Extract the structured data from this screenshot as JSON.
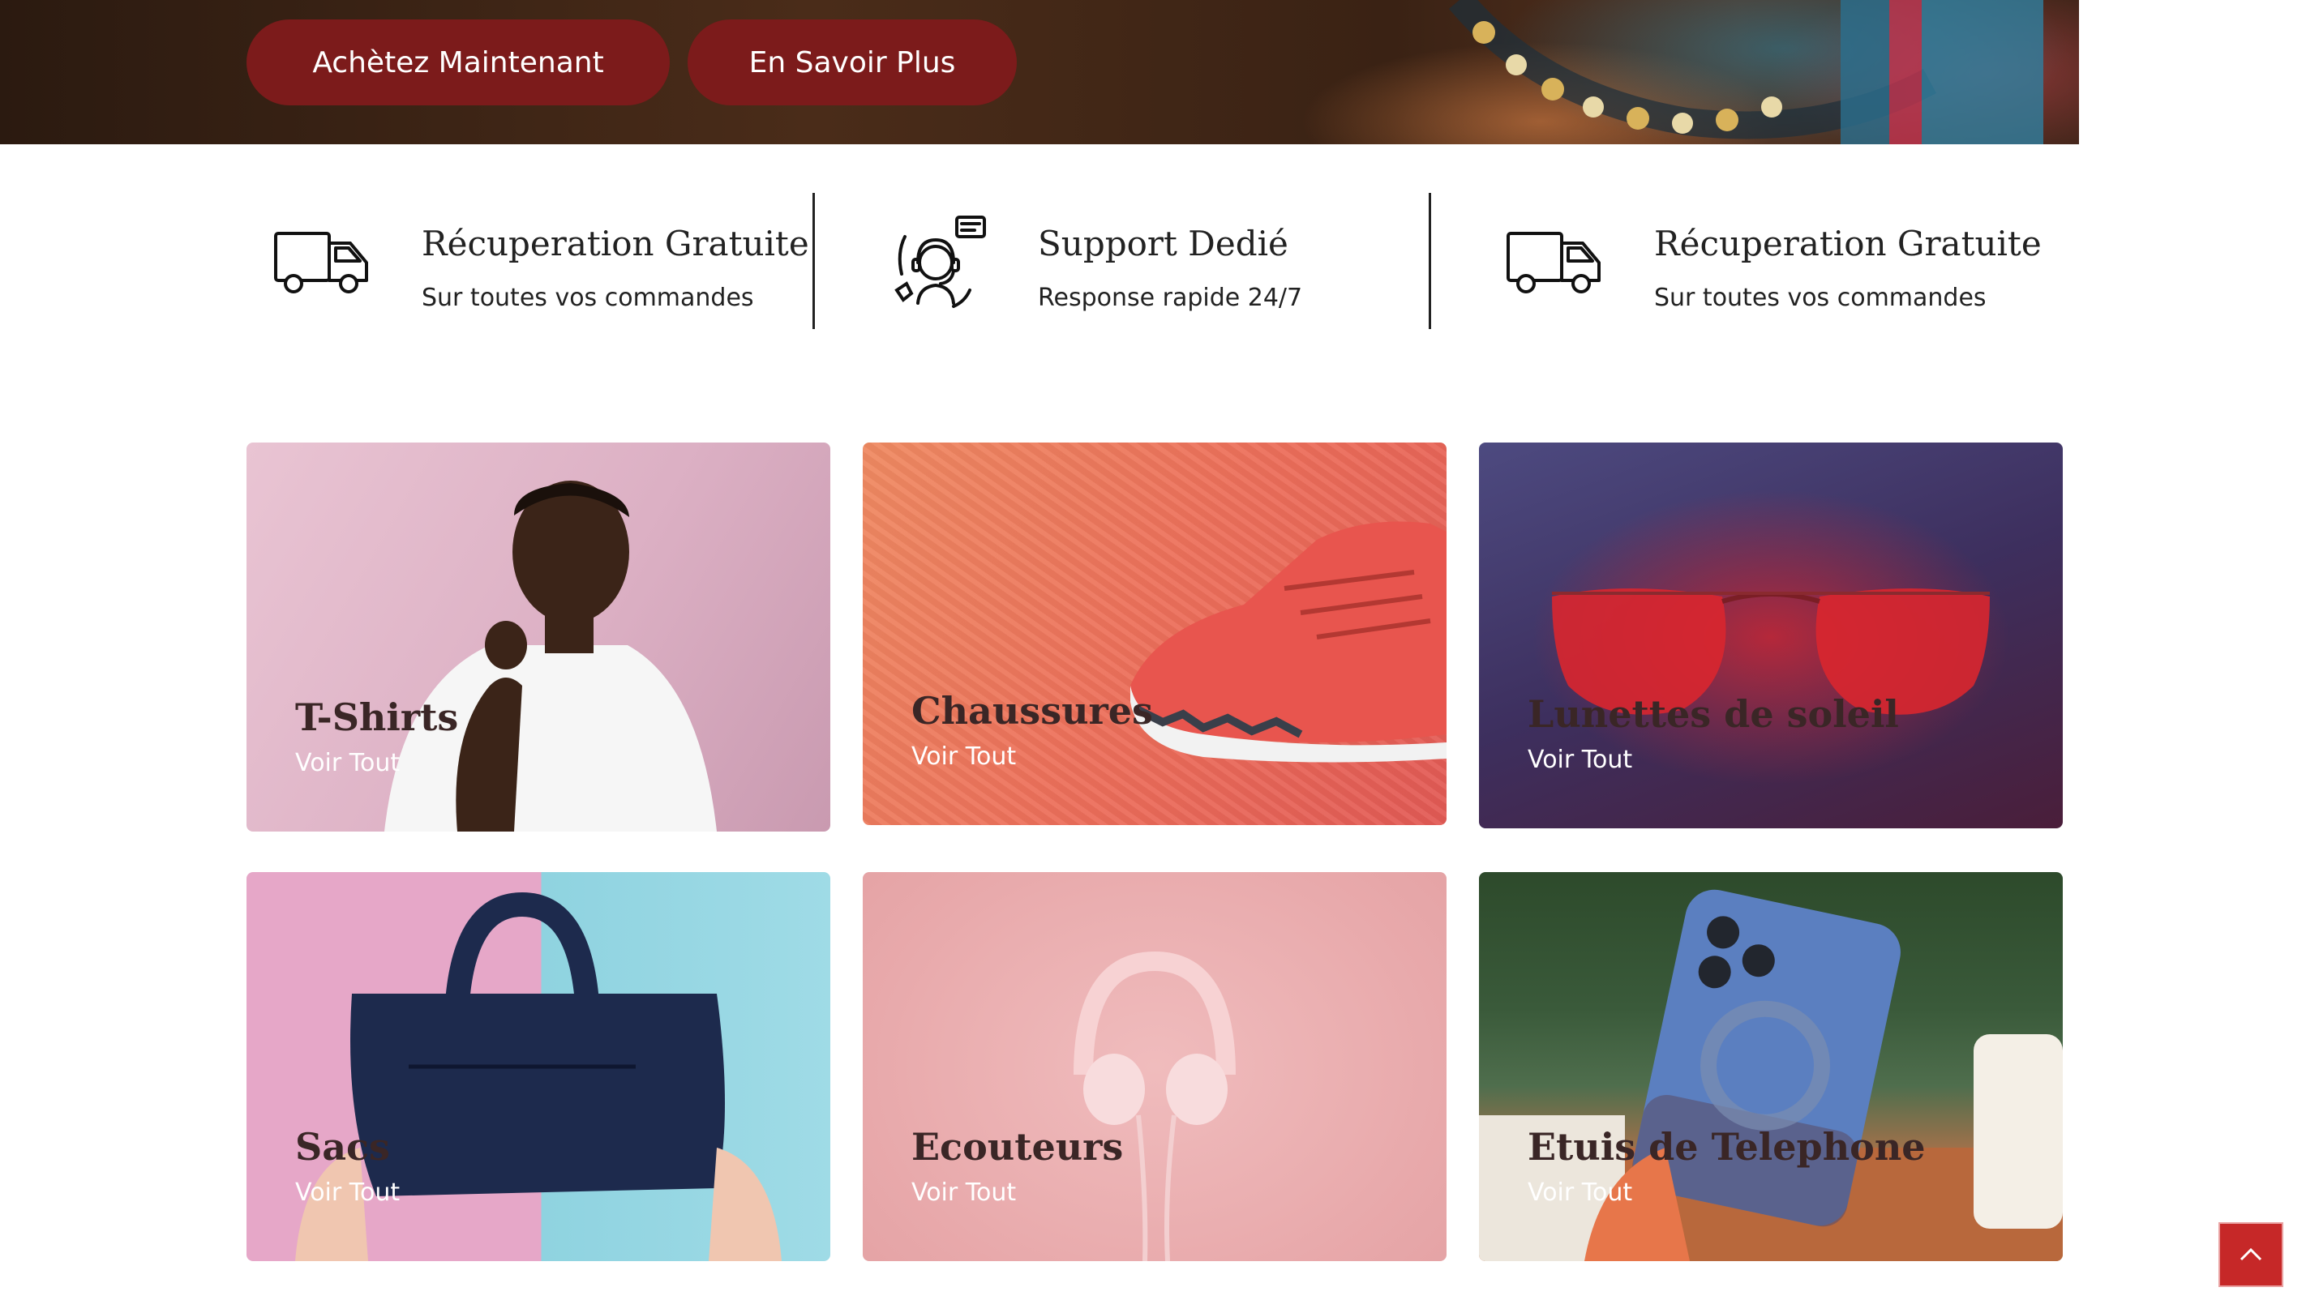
{
  "hero": {
    "buy_label": "Achètez Maintenant",
    "more_label": "En Savoir Plus"
  },
  "features": [
    {
      "icon": "delivery-van-icon",
      "title": "Récuperation Gratuite",
      "subtitle": "Sur toutes vos commandes"
    },
    {
      "icon": "customer-support-icon",
      "title": "Support Dedié",
      "subtitle": "Response rapide 24/7"
    },
    {
      "icon": "delivery-van-icon",
      "title": "Récuperation Gratuite",
      "subtitle": "Sur toutes vos commandes"
    }
  ],
  "categories": [
    {
      "title": "T-Shirts",
      "link": "Voir Tout"
    },
    {
      "title": "Chaussures",
      "link": "Voir Tout"
    },
    {
      "title": "Lunettes de soleil",
      "link": "Voir Tout"
    },
    {
      "title": "Sacs",
      "link": "Voir Tout"
    },
    {
      "title": "Ecouteurs",
      "link": "Voir Tout"
    },
    {
      "title": "Etuis de Telephone",
      "link": "Voir Tout"
    }
  ],
  "scroll_top": {
    "icon": "chevron-up-icon"
  },
  "colors": {
    "button": "#7c1b1b",
    "scroll_top": "#c62828",
    "divider": "#222222"
  }
}
